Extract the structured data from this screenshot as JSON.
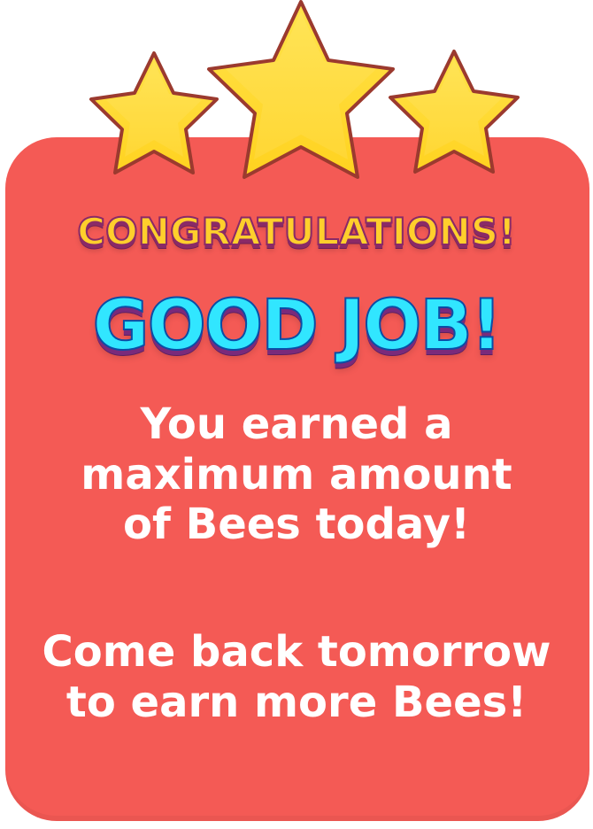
{
  "reward_popup": {
    "congratulations_text": "CONGRATULATIONS!",
    "headline_text": "GOOD JOB!",
    "message_lines": [
      "You earned a",
      "maximum amount",
      "of Bees today!"
    ],
    "followup_lines": [
      "Come back tomorrow",
      "to earn more Bees!"
    ],
    "star_count": 3,
    "icons": {
      "star_left": "star-icon",
      "star_center": "star-icon",
      "star_right": "star-icon"
    },
    "colors": {
      "card_background": "#f45a55",
      "star_fill": "#ffd63a",
      "star_outline": "#9b3a2f",
      "congratulations_fill": "#ffcf2c",
      "headline_fill": "#31e6ff",
      "message_text": "#ffffff"
    }
  }
}
